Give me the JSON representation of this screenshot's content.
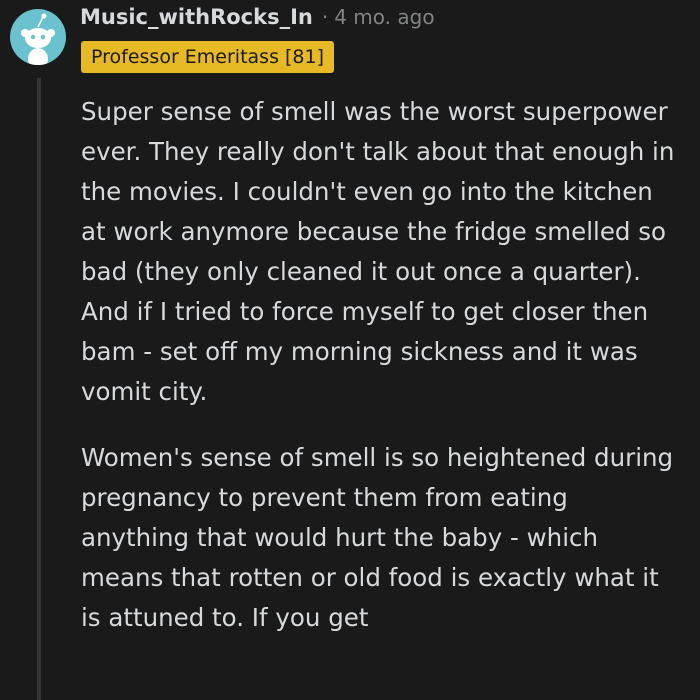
{
  "comment": {
    "username": "Music_withRocks_In",
    "separator": "·",
    "timestamp": "4 mo. ago",
    "flair": "Professor Emeritass [81]",
    "avatar_icon": "snoo-avatar-icon",
    "paragraphs": [
      "Super sense of smell was the worst superpower ever. They really don't talk about that enough in the movies. I couldn't even go into the kitchen at work anymore because the fridge smelled so bad (they only cleaned it out once a quarter). And if I tried to force myself to get closer then bam - set off my morning sickness and it was vomit city.",
      "Women's sense of smell is so heightened during pregnancy to prevent them from eating anything that would hurt the baby - which means that rotten or old food is exactly what it is attuned to. If you get"
    ]
  },
  "colors": {
    "background": "#1a1a1b",
    "text": "#d7dadc",
    "meta": "#818384",
    "flair_bg": "#e7b925",
    "avatar_bg": "#6ac2cf",
    "thread_line": "#343536"
  }
}
